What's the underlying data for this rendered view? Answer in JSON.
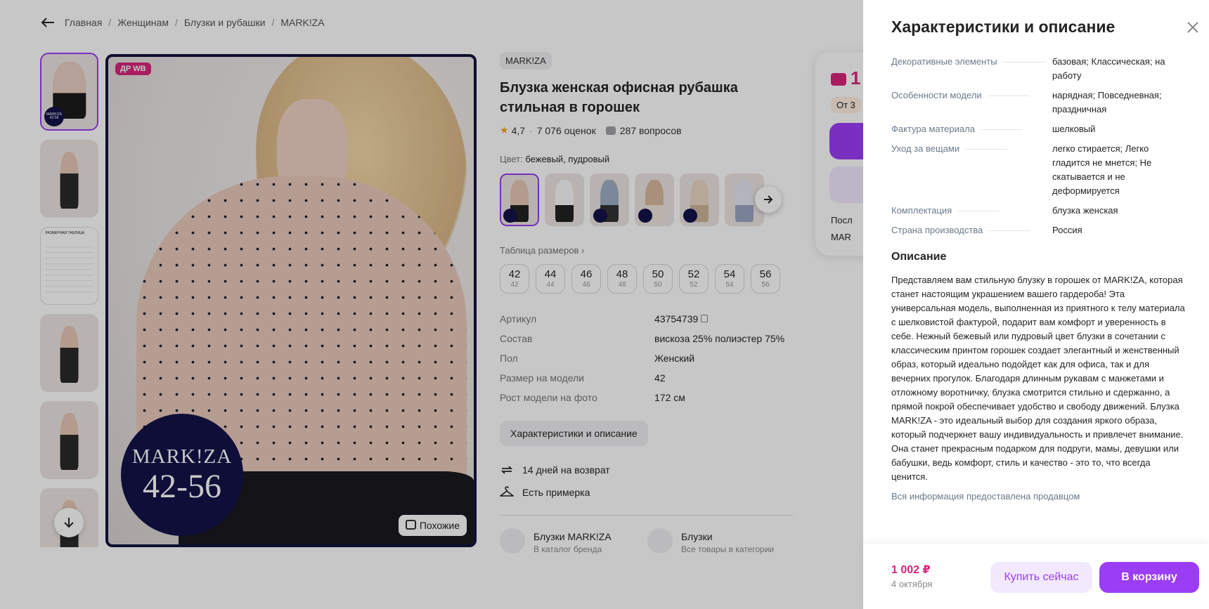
{
  "breadcrumbs": [
    "Главная",
    "Женщинам",
    "Блузки и рубашки",
    "MARK!ZA"
  ],
  "gallery": {
    "badge": "ДР WB",
    "logo_brand": "MARK!ZA",
    "logo_sizes": "42-56",
    "thumb_logo": "MARK!ZA 42-56",
    "size_table_title": "РАЗМЕРНАЯ ТАБЛИЦА",
    "similar_label": "Похожие"
  },
  "product": {
    "brand": "MARK!ZA",
    "title": "Блузка женская офисная рубашка стильная в горошек",
    "rating": "4,7",
    "reviews": "7 076 оценок",
    "questions": "287 вопросов",
    "color_label": "Цвет:",
    "color_value": "бежевый, пудровый",
    "size_table_link": "Таблица размеров",
    "sizes": [
      {
        "ru": "42",
        "intl": "42"
      },
      {
        "ru": "44",
        "intl": "44"
      },
      {
        "ru": "46",
        "intl": "46"
      },
      {
        "ru": "48",
        "intl": "48"
      },
      {
        "ru": "50",
        "intl": "50"
      },
      {
        "ru": "52",
        "intl": "52"
      },
      {
        "ru": "54",
        "intl": "54"
      },
      {
        "ru": "56",
        "intl": "56"
      }
    ],
    "specs": [
      {
        "k": "Артикул",
        "v": "43754739"
      },
      {
        "k": "Состав",
        "v": "вискоза 25% полиэстер 75%"
      },
      {
        "k": "Пол",
        "v": "Женский"
      },
      {
        "k": "Размер на модели",
        "v": "42"
      },
      {
        "k": "Рост модели на фото",
        "v": "172 см"
      }
    ],
    "char_button": "Характеристики и описание",
    "return_text": "14 дней на возврат",
    "fitting_text": "Есть примерка",
    "brand_card_title": "Блузки MARK!ZA",
    "brand_card_sub": "В каталог бренда",
    "cat_card_title": "Блузки",
    "cat_card_sub": "Все товары в категории"
  },
  "buybox": {
    "price_partial": "1",
    "from_partial": "От 3",
    "line1_partial": "Посл",
    "line2_partial": "MAR"
  },
  "drawer": {
    "title": "Характеристики и описание",
    "rows": [
      {
        "k": "Декоративные элементы",
        "v": "базовая; Классическая; на работу"
      },
      {
        "k": "Особенности модели",
        "v": "нарядная; Повседневная; праздничная"
      },
      {
        "k": "Фактура материала",
        "v": "шелковый"
      },
      {
        "k": "Уход за вещами",
        "v": "легко стирается; Легко гладится не мнется; Не скатывается и не деформируется"
      },
      {
        "k": "Комплектация",
        "v": "блузка женская"
      },
      {
        "k": "Страна производства",
        "v": "Россия"
      }
    ],
    "desc_heading": "Описание",
    "description": "Представляем вам стильную блузку в горошек от MARK!ZA, которая станет настоящим украшением вашего гардероба! Эта универсальная модель, выполненная из приятного к телу материала с шелковистой фактурой, подарит вам комфорт и уверенность в себе. Нежный бежевый или пудровый цвет блузки в сочетании с классическим принтом горошек создает элегантный и женственный образ, который идеально подойдет как для офиса, так и для вечерних прогулок. Благодаря длинным рукавам с манжетами и отложному воротничку, блузка смотрится стильно и сдержанно, а прямой покрой обеспечивает удобство и свободу движений. Блузка MARK!ZA - это идеальный выбор для создания яркого образа, который подчеркнет вашу индивидуальность и привлечет внимание. Она станет прекрасным подарком для подруги, мамы, девушки или бабушки, ведь комфорт, стиль и качество - это то, что всегда ценится.",
    "seller_note": "Вся информация предоставлена продавцом",
    "footer": {
      "price": "1 002 ₽",
      "date": "4 октября",
      "buy_now": "Купить сейчас",
      "to_cart": "В корзину"
    }
  },
  "colors": {
    "accent": "#9b3df5",
    "price": "#d9267b",
    "logo_navy": "#13134a"
  }
}
